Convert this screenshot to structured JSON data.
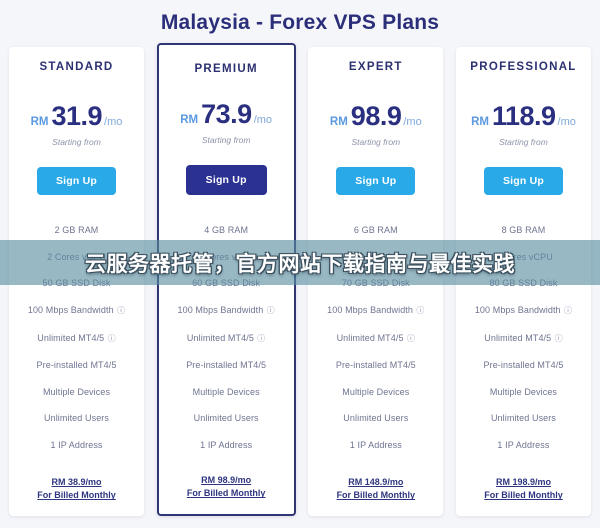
{
  "header": {
    "title": "Malaysia - Forex VPS Plans",
    "title_color": "#2b2f7a"
  },
  "overlay": {
    "text": "云服务器托管，官方网站下载指南与最佳实践",
    "band_color": "#588ca0",
    "text_color": "#ffffff"
  },
  "common": {
    "currency": "RM",
    "per_period": "/mo",
    "starting_from": "Starting from",
    "signup_label": "Sign Up",
    "billed_suffix": "For Billed Monthly",
    "info_icon": "?",
    "accent_light": "#29a9e8",
    "accent_dark": "#2b3191"
  },
  "plans": [
    {
      "name": "STANDARD",
      "price": "31.9",
      "featured": false,
      "button_style": "light",
      "features": [
        "2 GB RAM",
        "2 Cores vCPU",
        "50 GB SSD Disk",
        "100 Mbps Bandwidth",
        "Unlimited MT4/5",
        "Pre-installed MT4/5",
        "Multiple Devices",
        "Unlimited Users",
        "1 IP Address"
      ],
      "feature_has_info": [
        false,
        false,
        false,
        true,
        true,
        false,
        false,
        false,
        false
      ],
      "monthly_price": "RM 38.9/mo"
    },
    {
      "name": "PREMIUM",
      "price": "73.9",
      "featured": true,
      "button_style": "dark",
      "features": [
        "4 GB RAM",
        "4 Cores vCPU",
        "60 GB SSD Disk",
        "100 Mbps Bandwidth",
        "Unlimited MT4/5",
        "Pre-installed MT4/5",
        "Multiple Devices",
        "Unlimited Users",
        "1 IP Address"
      ],
      "feature_has_info": [
        false,
        false,
        false,
        true,
        true,
        false,
        false,
        false,
        false
      ],
      "monthly_price": "RM 98.9/mo"
    },
    {
      "name": "EXPERT",
      "price": "98.9",
      "featured": false,
      "button_style": "light",
      "features": [
        "6 GB RAM",
        "6 Cores vCPU",
        "70 GB SSD Disk",
        "100 Mbps Bandwidth",
        "Unlimited MT4/5",
        "Pre-installed MT4/5",
        "Multiple Devices",
        "Unlimited Users",
        "1 IP Address"
      ],
      "feature_has_info": [
        false,
        false,
        false,
        true,
        true,
        false,
        false,
        false,
        false
      ],
      "monthly_price": "RM 148.9/mo"
    },
    {
      "name": "PROFESSIONAL",
      "price": "118.9",
      "featured": false,
      "button_style": "light",
      "features": [
        "8 GB RAM",
        "8 Cores vCPU",
        "80 GB SSD Disk",
        "100 Mbps Bandwidth",
        "Unlimited MT4/5",
        "Pre-installed MT4/5",
        "Multiple Devices",
        "Unlimited Users",
        "1 IP Address"
      ],
      "feature_has_info": [
        false,
        false,
        false,
        true,
        true,
        false,
        false,
        false,
        false
      ],
      "monthly_price": "RM 198.9/mo"
    }
  ]
}
